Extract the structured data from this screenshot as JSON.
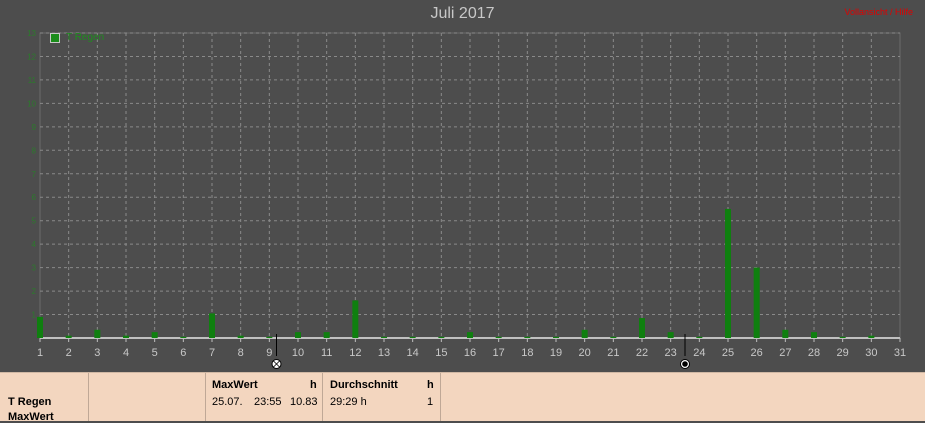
{
  "header": {
    "title": "Juli 2017",
    "corner_link": "Vollansicht / Hilfe"
  },
  "legend": {
    "label": "T Regen",
    "color": "#1a8c1a"
  },
  "colors": {
    "background": "#4d4d4d",
    "grid": "#8a8a8a",
    "axis": "#c0c0c0",
    "bar": "#0f7f0f",
    "footer_bg": "#f3d6bf",
    "accent_red": "#e00000"
  },
  "markers": {
    "full_moon_day": 9.25,
    "new_moon_day": 23.5
  },
  "chart_data": {
    "type": "bar",
    "title": "Juli 2017",
    "xlabel": "",
    "ylabel": "",
    "xlim": [
      1,
      31
    ],
    "ylim": [
      0,
      13
    ],
    "x_ticks": [
      "1",
      "2",
      "3",
      "4",
      "5",
      "6",
      "7",
      "8",
      "9",
      "10",
      "11",
      "12",
      "13",
      "14",
      "15",
      "16",
      "17",
      "18",
      "19",
      "20",
      "21",
      "22",
      "23",
      "24",
      "25",
      "26",
      "27",
      "28",
      "29",
      "30",
      "31"
    ],
    "y_ticks": [
      1,
      2,
      3,
      4,
      5,
      6,
      7,
      8,
      9,
      10,
      11,
      12,
      13
    ],
    "grid": true,
    "legend_position": "top-left",
    "series": [
      {
        "name": "T Regen",
        "x": [
          1,
          2,
          3,
          4,
          5,
          6,
          7,
          8,
          9,
          10,
          11,
          12,
          13,
          14,
          15,
          16,
          17,
          18,
          19,
          20,
          21,
          22,
          23,
          24,
          25,
          26,
          27,
          28,
          29,
          30
        ],
        "values": [
          0.9,
          0.1,
          0.35,
          0.1,
          0.25,
          0.05,
          1.05,
          0.1,
          0.05,
          0.25,
          0.25,
          1.6,
          0.05,
          0.05,
          0.05,
          0.25,
          0.05,
          0.05,
          0.05,
          0.35,
          0.05,
          0.85,
          0.25,
          0.05,
          5.5,
          3.0,
          0.35,
          0.25,
          0.05,
          0.1
        ]
      }
    ]
  },
  "footer": {
    "series_label": "T Regen",
    "maxwert_label": "MaxWert",
    "col_max_header": "MaxWert",
    "col_max_unit": "h",
    "col_max_date": "25.07.",
    "col_max_time": "23:55",
    "col_max_value": "10.83",
    "col_avg_header": "Durchschnitt",
    "col_avg_unit": "h",
    "col_avg_value": "29:29 h",
    "col_avg_count": "1"
  }
}
